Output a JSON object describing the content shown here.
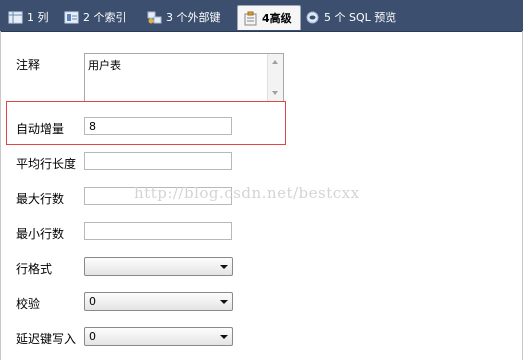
{
  "tabs": [
    {
      "label": "1 列",
      "icon": "table-columns-icon",
      "active": false
    },
    {
      "label": "2 个索引",
      "icon": "index-icon",
      "active": false
    },
    {
      "label": "3 个外部键",
      "icon": "foreign-key-icon",
      "active": false
    },
    {
      "label": "4高级",
      "icon": "advanced-options-icon",
      "active": true
    },
    {
      "label": "5 个 SQL 预览",
      "icon": "sql-preview-icon",
      "active": false
    }
  ],
  "form": {
    "comment": {
      "label": "注释",
      "value": "用户表"
    },
    "auto_increment": {
      "label": "自动增量",
      "value": "8"
    },
    "avg_row_length": {
      "label": "平均行长度",
      "value": ""
    },
    "max_rows": {
      "label": "最大行数",
      "value": ""
    },
    "min_rows": {
      "label": "最小行数",
      "value": ""
    },
    "row_format": {
      "label": "行格式",
      "value": ""
    },
    "checksum": {
      "label": "校验",
      "value": "0"
    },
    "delay_key_write": {
      "label": "延迟键写入",
      "value": "0"
    }
  },
  "watermark": "http://blog.csdn.net/bestcxx",
  "colors": {
    "tab_bar": "#3c4f6e",
    "highlight_border": "#e04848"
  }
}
